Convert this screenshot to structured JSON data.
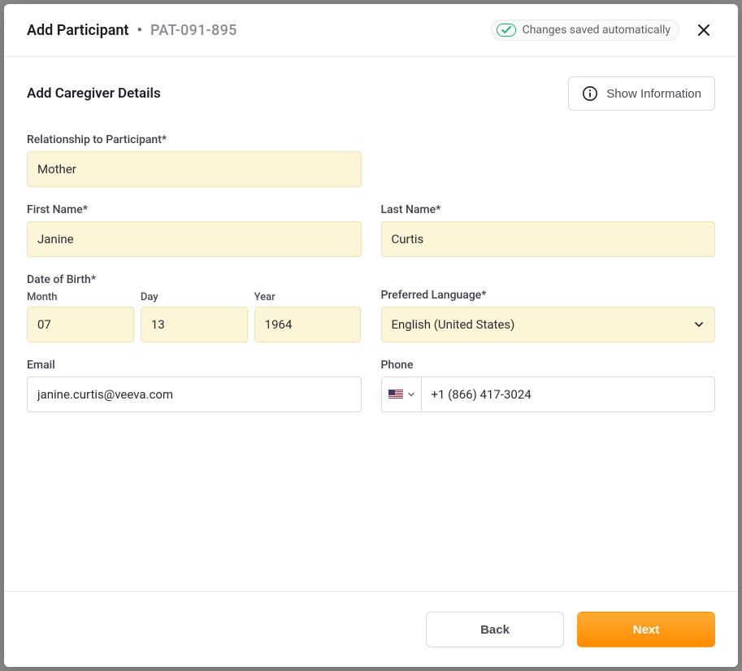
{
  "header": {
    "title": "Add Participant",
    "patient_id": "PAT-091-895",
    "saved_label": "Changes saved automatically"
  },
  "section": {
    "title": "Add Caregiver Details",
    "show_info_label": "Show Information"
  },
  "fields": {
    "relationship": {
      "label": "Relationship to Participant*",
      "value": "Mother"
    },
    "first_name": {
      "label": "First Name*",
      "value": "Janine"
    },
    "last_name": {
      "label": "Last Name*",
      "value": "Curtis"
    },
    "dob": {
      "label": "Date of Birth*",
      "month_label": "Month",
      "month": "07",
      "day_label": "Day",
      "day": "13",
      "year_label": "Year",
      "year": "1964"
    },
    "language": {
      "label": "Preferred Language*",
      "value": "English (United States)"
    },
    "email": {
      "label": "Email",
      "value": "janine.curtis@veeva.com"
    },
    "phone": {
      "label": "Phone",
      "value": "+1 (866) 417-3024",
      "country": "US"
    }
  },
  "footer": {
    "back": "Back",
    "next": "Next"
  }
}
